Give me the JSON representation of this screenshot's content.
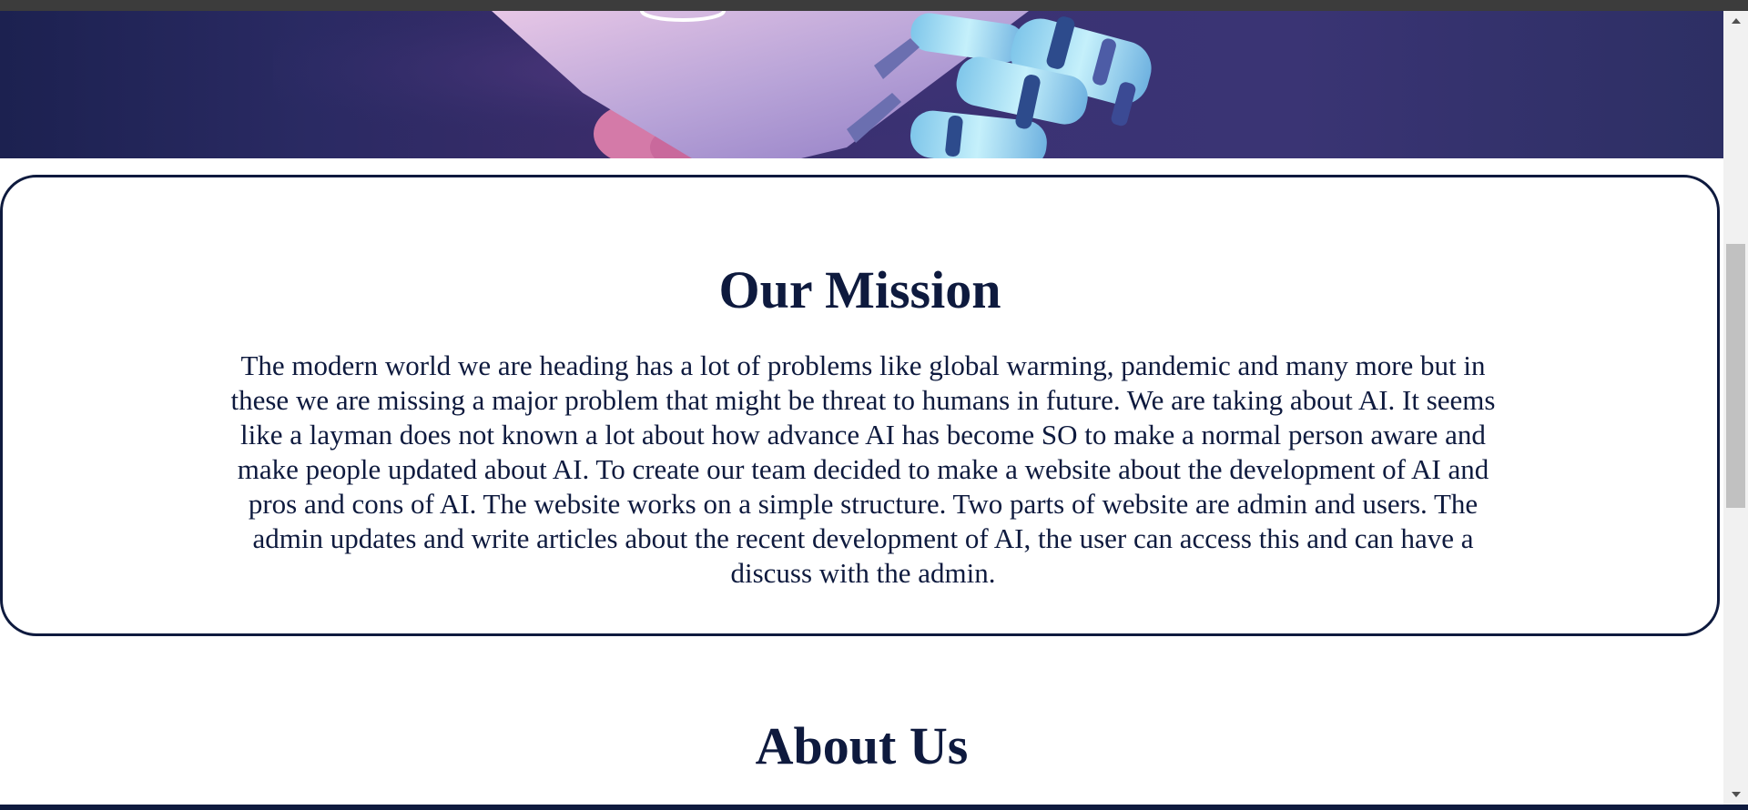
{
  "hero": {
    "image_alt": "robot hand illustration",
    "colors": {
      "background": "#2f2d6a",
      "robot_finger": "#a6e0f2",
      "human_hand": "#d47aa8"
    }
  },
  "mission": {
    "title": "Our Mission",
    "body": "The modern world we are heading has a lot of problems like global warming, pandemic and many more but in these we are missing a major problem that might be threat to humans in future. We are taking about AI. It seems like a layman does not known a lot about how advance AI has become SO to make a normal person aware and make people updated about AI. To create our team decided to make a website about the development of AI and pros and cons of AI. The website works on a simple structure. Two parts of website are admin and users. The admin updates and write articles about the recent development of AI, the user can access this and can have a discuss with the admin."
  },
  "about": {
    "title": "About Us"
  },
  "colors": {
    "accent": "#0e1a3e",
    "scrollbar_track": "#f1f1f1",
    "scrollbar_thumb": "#c1c1c1"
  },
  "icons": {
    "scroll_up": "triangle-up-icon",
    "scroll_down": "triangle-down-icon"
  }
}
